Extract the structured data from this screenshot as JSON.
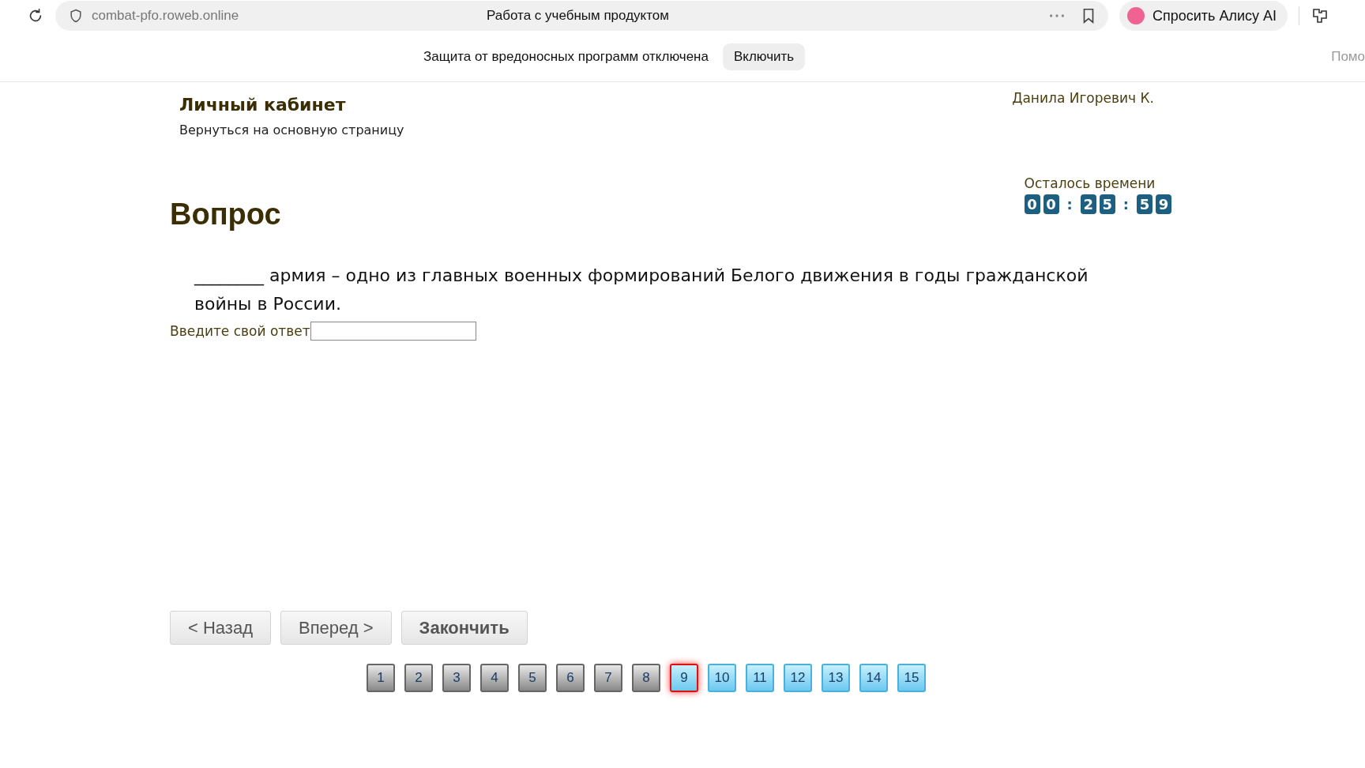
{
  "browser": {
    "url": "combat-pfo.roweb.online",
    "page_title": "Работа с учебным продуктом",
    "assistant_button": "Спросить Алису AI"
  },
  "security_bar": {
    "message": "Защита от вредоносных программ отключена",
    "enable_button": "Включить",
    "help_link": "Помо"
  },
  "header": {
    "title": "Личный кабинет",
    "back_link": "Вернуться на основную страницу",
    "user_name": "Данила Игоревич К."
  },
  "timer": {
    "label": "Осталось времени",
    "cells": [
      {
        "kind": "digit",
        "text": "0"
      },
      {
        "kind": "digit",
        "text": "0"
      },
      {
        "kind": "separator",
        "text": ":"
      },
      {
        "kind": "digit",
        "text": "2"
      },
      {
        "kind": "digit",
        "text": "5"
      },
      {
        "kind": "separator",
        "text": ":"
      },
      {
        "kind": "digit",
        "text": "5"
      },
      {
        "kind": "digit",
        "text": "9"
      }
    ]
  },
  "question": {
    "heading": "Вопрос",
    "text": "________ армия – одно из главных военных формирований Белого движения в годы гражданской войны в России.",
    "answer_label": "Введите свой ответ"
  },
  "buttons": [
    {
      "label": "< Назад",
      "bold": false
    },
    {
      "label": "Вперед >",
      "bold": false
    },
    {
      "label": "Закончить",
      "bold": true
    }
  ],
  "pages": [
    {
      "label": "1",
      "answered": true,
      "selected": false
    },
    {
      "label": "2",
      "answered": true,
      "selected": false
    },
    {
      "label": "3",
      "answered": true,
      "selected": false
    },
    {
      "label": "4",
      "answered": true,
      "selected": false
    },
    {
      "label": "5",
      "answered": true,
      "selected": false
    },
    {
      "label": "6",
      "answered": true,
      "selected": false
    },
    {
      "label": "7",
      "answered": true,
      "selected": false
    },
    {
      "label": "8",
      "answered": true,
      "selected": false
    },
    {
      "label": "9",
      "answered": false,
      "selected": true
    },
    {
      "label": "10",
      "answered": false,
      "selected": false
    },
    {
      "label": "11",
      "answered": false,
      "selected": false
    },
    {
      "label": "12",
      "answered": false,
      "selected": false
    },
    {
      "label": "13",
      "answered": false,
      "selected": false
    },
    {
      "label": "14",
      "answered": false,
      "selected": false
    },
    {
      "label": "15",
      "answered": false,
      "selected": false
    }
  ]
}
